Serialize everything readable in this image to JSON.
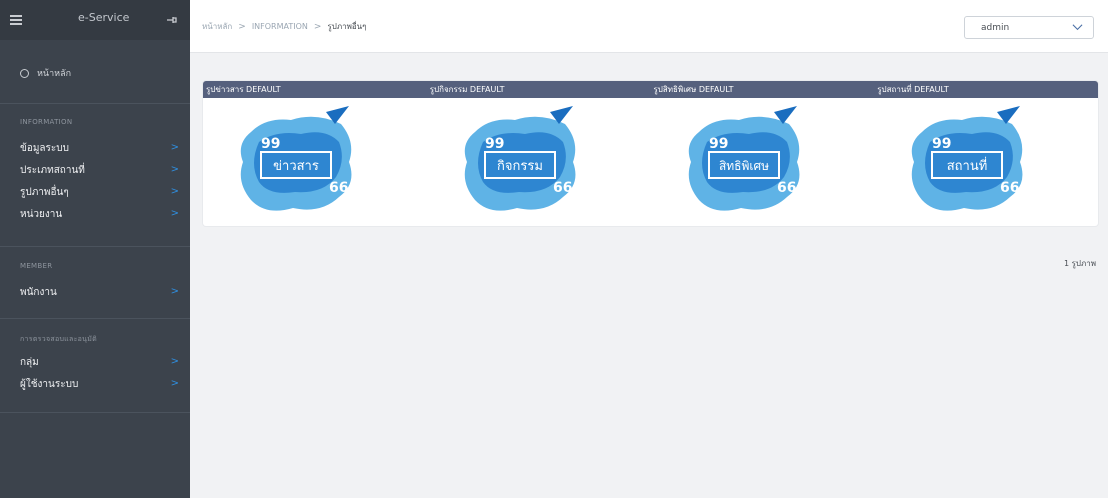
{
  "sidebar": {
    "title": "e-Service",
    "home_label": "หน้าหลัก",
    "sections": [
      {
        "label": "INFORMATION",
        "items": [
          "ข้อมูลระบบ",
          "ประเภทสถานที่",
          "รูปภาพอื่นๆ",
          "หน่วยงาน"
        ]
      },
      {
        "label": "MEMBER",
        "items": [
          "พนักงาน"
        ]
      },
      {
        "label": "การตรวจสอบและอนุมัติ",
        "items": [
          "กลุ่ม",
          "ผู้ใช้งานระบบ"
        ]
      }
    ]
  },
  "topbar": {
    "breadcrumb": [
      "หน้าหลัก",
      "INFORMATION",
      "รูปภาพอื่นๆ"
    ],
    "user_select": "admin"
  },
  "gallery": {
    "columns": [
      "รูปข่าวสาร DEFAULT",
      "รูปกิจกรรม DEFAULT",
      "รูปสิทธิพิเศษ DEFAULT",
      "รูปสถานที่ DEFAULT"
    ],
    "images": [
      "ข่าวสาร",
      "กิจกรรม",
      "สิทธิพิเศษ",
      "สถานที่"
    ]
  },
  "footer": {
    "count_text": "1 รูปภาพ"
  },
  "colors": {
    "sidebar_bg": "#3c434c",
    "accent": "#2f8fe0",
    "card_header": "#55607d"
  }
}
